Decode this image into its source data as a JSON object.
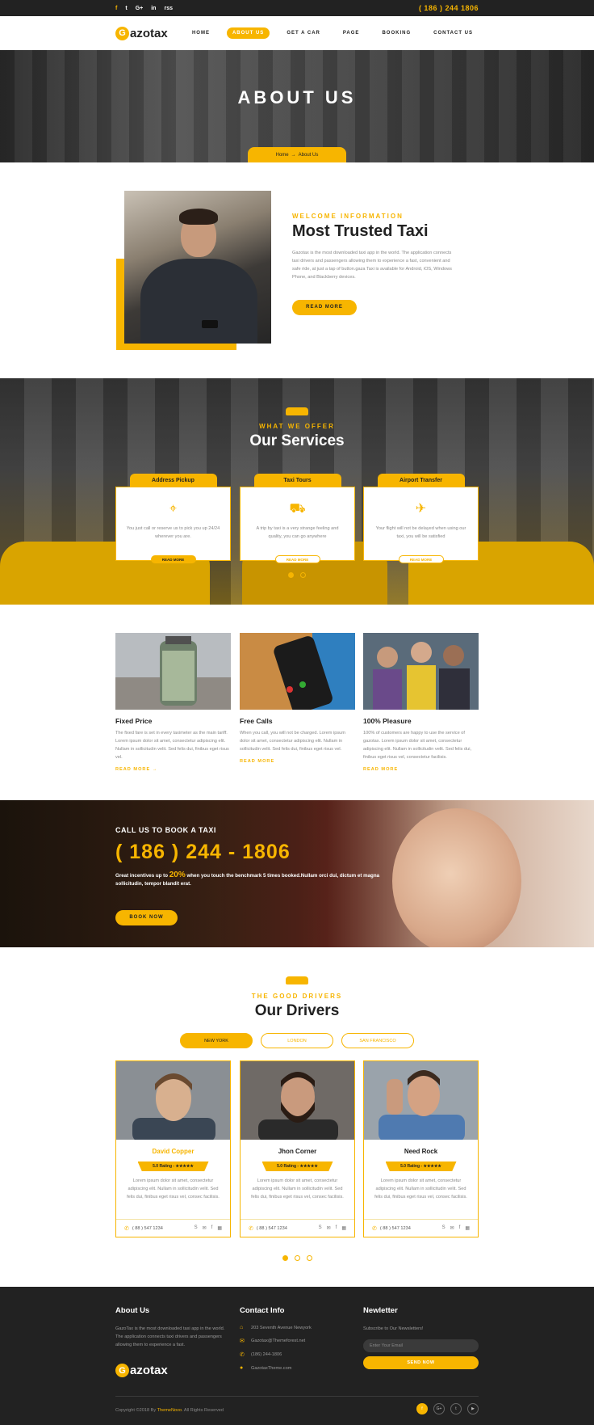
{
  "topbar": {
    "social": [
      "f",
      "t",
      "G+",
      "in",
      "rss"
    ],
    "phone": "( 186 ) 244 1806"
  },
  "header": {
    "logo_letter": "G",
    "logo_text": "azotax",
    "nav": [
      "HOME",
      "ABOUT US",
      "GET A CAR",
      "PAGE",
      "BOOKING",
      "CONTACT US"
    ]
  },
  "hero": {
    "title": "ABOUT US",
    "crumb_home": "Home",
    "crumb_sep": "→",
    "crumb_current": "About Us"
  },
  "about": {
    "kicker": "WELCOME INFORMATION",
    "title": "Most Trusted Taxi",
    "body": "Gazotax is the most downloaded taxi app in the world. The application connects taxi drivers and passengers allowing them to experience a fast, convenient and safe ride, at just a tap of button.gaza Taxi is available for Android, iOS, Windows Phone, and Blackberry devices.",
    "button": "READ MORE"
  },
  "services": {
    "kicker": "WHAT WE OFFER",
    "title": "Our Services",
    "items": [
      {
        "title": "Address Pickup",
        "icon": "map-pin-icon",
        "glyph": "⌖",
        "text": "You just call or reserve us to pick you up 24/24 wherever you are.",
        "button": "READ MORE"
      },
      {
        "title": "Taxi Tours",
        "icon": "taxi-icon",
        "glyph": "⛟",
        "text": "A trip by taxi is a very strange feeling and quality, you can go anywhere",
        "button": "READ MORE"
      },
      {
        "title": "Airport Transfer",
        "icon": "airplane-icon",
        "glyph": "✈",
        "text": "Your flight will not be delayed when using our taxi, you will be satisfied",
        "button": "READ MORE"
      }
    ]
  },
  "features": [
    {
      "title": "Fixed Price",
      "text": "The fixed fare is set in every taximeter as the main tariff. Lorem ipsum dolor sit amet, consectetur adipiscing elit. Nullam in sollicitudin velit. Sed felis dui, finibus eget risus vel.",
      "link": "READ MORE →"
    },
    {
      "title": "Free Calls",
      "text": "When you call, you will not be charged. Lorem ipsum dolor sit amet, consectetur adipiscing elit. Nullam in sollicitudin velit. Sed felis dui, finibus eget risus vel.",
      "link": "READ MORE"
    },
    {
      "title": "100% Pleasure",
      "text": "100% of customers are happy to use the service of gazotax. Lorem ipsum dolor sit amet, consectetur adipiscing elit. Nullam in sollicitudin velit. Sed felis dui, finibus eget risus vel, consectetur facilisis.",
      "link": "READ MORE"
    }
  ],
  "call": {
    "kicker": "CALL US TO BOOK A TAXI",
    "phone": "( 186 ) 244 - 1806",
    "line_pre": "Great incentives up to ",
    "line_pct": "20%",
    "line_post": " when you touch the benchmark 5 times booked.Nullam orci dui, dictum et magna sollicitudin, tempor blandit erat.",
    "button": "BOOK NOW"
  },
  "drivers": {
    "kicker": "THE GOOD DRIVERS",
    "title": "Our Drivers",
    "tabs": [
      "NEW YORK",
      "LONDON",
      "SAN FRANCISCO"
    ],
    "items": [
      {
        "name": "David Copper",
        "rating": "5.0 Rating - ★★★★★",
        "text": "Lorem ipsum dolor sit amet, consectetur adipiscing elit. Nullam in sollicitudin velit. Sed felis dui, finibus eget risus vel, consec facilisis.",
        "phone": "( 88 ) 547 1234"
      },
      {
        "name": "Jhon Corner",
        "rating": "5.0 Rating - ★★★★★",
        "text": "Lorem ipsum dolor sit amet, consectetur adipiscing elit. Nullam in sollicitudin velit. Sed felis dui, finibus eget risus vel, consec facilisis.",
        "phone": "( 88 ) 547 1234"
      },
      {
        "name": "Need Rock",
        "rating": "5.0 Rating - ★★★★★",
        "text": "Lorem ipsum dolor sit amet, consectetur adipiscing elit. Nullam in sollicitudin velit. Sed felis dui, finibus eget risus vel, consec facilisis.",
        "phone": "( 88 ) 547 1234"
      }
    ]
  },
  "footer": {
    "about_title": "About Us",
    "about_text": "GazoTax is the most downloaded taxi app in the world. The application connects taxi drivers and passengers allowing them to experience a fast.",
    "logo_letter": "G",
    "logo_text": "azotax",
    "contact_title": "Contact Info",
    "contacts": [
      {
        "icon": "home-icon",
        "glyph": "⌂",
        "text": "203 Seventh Avenue Newyork"
      },
      {
        "icon": "mail-icon",
        "glyph": "✉",
        "text": "Gazotax@Themeforest.net"
      },
      {
        "icon": "phone-icon",
        "glyph": "✆",
        "text": "(186) 244-1806"
      },
      {
        "icon": "globe-icon",
        "glyph": "●",
        "text": "GazotaxTheme.com"
      }
    ],
    "news_title": "Newletter",
    "news_text": "Subscribe to Our Newsletters!",
    "news_placeholder": "Enter Your Email",
    "news_button": "SEND NOW",
    "copy_pre": "Copyright ©2018 By ",
    "copy_brand": "ThemeNovo",
    "copy_post": ". All Rights Reserved",
    "social": [
      "f",
      "G+",
      "t",
      "▶"
    ]
  },
  "colors": {
    "accent": "#f7b500",
    "dark": "#222222"
  }
}
